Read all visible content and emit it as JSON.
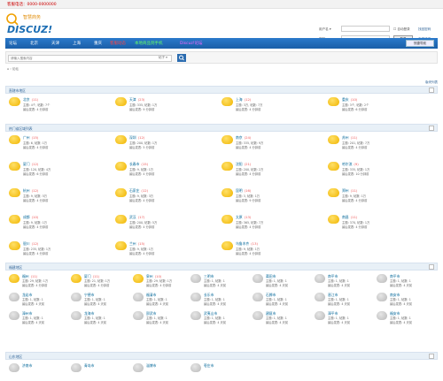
{
  "topbar": {
    "text": "客服电话：0000-0000000"
  },
  "header": {
    "logo_top": "智慧商务",
    "logo_main": "DISCUZ!"
  },
  "login": {
    "user_label": "用户名",
    "user_select": "用户名 ▾",
    "remember": "自动登录",
    "find_pwd": "找回密码",
    "pwd_label": "密码",
    "login_btn": "登录",
    "register": "立即注册"
  },
  "nav": {
    "items": [
      {
        "label": "论坛",
        "color": "#ffffff"
      },
      {
        "label": "北京",
        "color": "#ffffff"
      },
      {
        "label": "天津",
        "color": "#ffffff"
      },
      {
        "label": "上海",
        "color": "#ffffff"
      },
      {
        "label": "重庆",
        "color": "#ffffff"
      },
      {
        "label": "客服动态",
        "color": "#ff4444"
      },
      {
        "label": "本地商品到手机",
        "color": "#66ff66"
      },
      {
        "label": "Discuz!论坛",
        "color": "#ff66ff"
      }
    ],
    "right_button": "快捷导航"
  },
  "search": {
    "placeholder": "请输入搜索内容",
    "select": "帖子 ▾"
  },
  "breadcrumb": "⌂ › 论坛",
  "crumb_right": "版块列表",
  "sections": [
    {
      "title": "直辖市地区",
      "forums": [
        {
          "name": "北京",
          "new": "(11)",
          "stat": "主题: 4个, 帖数: 7个",
          "last": "最后发表: 4 分钟前"
        },
        {
          "name": "天津",
          "new": "(23)",
          "stat": "主题: 335, 帖数: 1万",
          "last": "最后发表: 9 分钟前"
        },
        {
          "name": "上海",
          "new": "(12)",
          "stat": "主题: 3万, 帖数: 7万",
          "last": "最后发表: 4 分钟前"
        },
        {
          "name": "重庆",
          "new": "(10)",
          "stat": "主题: 3个, 帖数: 2个",
          "last": "最后发表: 6 分钟前"
        }
      ]
    },
    {
      "title": "热门省区域列表",
      "forums": [
        {
          "name": "广州",
          "new": "(15)",
          "stat": "主题: 6, 帖数: 1万",
          "last": "最后发表: 4 分钟前"
        },
        {
          "name": "深圳",
          "new": "(12)",
          "stat": "主题: 200, 帖数: 1万",
          "last": "最后发表: 5 分钟前"
        },
        {
          "name": "南京",
          "new": "(24)",
          "stat": "主题: 335, 帖数: 9万",
          "last": "最后发表: 4 分钟前"
        },
        {
          "name": "苏州",
          "new": "(11)",
          "stat": "主题: 201, 帖数: 7万",
          "last": "最后发表: 4 分钟前"
        },
        {
          "name": "厦门",
          "new": "(12)",
          "stat": "主题: 120, 帖数: 4万",
          "last": "最后发表: 6 分钟前"
        },
        {
          "name": "长春市",
          "new": "(15)",
          "stat": "主题: 9, 帖数: 1万",
          "last": "最后发表: 4 分钟前"
        },
        {
          "name": "沈阳",
          "new": "(21)",
          "stat": "主题: 200, 帖数: 2万",
          "last": "最后发表: 4 分钟前"
        },
        {
          "name": "哈尔滨",
          "new": "(9)",
          "stat": "主题: 335, 帖数: 1万",
          "last": "最后发表: 10 分钟前"
        },
        {
          "name": "杭州",
          "new": "(12)",
          "stat": "主题: 9, 帖数: 5万",
          "last": "最后发表: 4 分钟前"
        },
        {
          "name": "石家庄",
          "new": "(12)",
          "stat": "主题: 9, 帖数: 3万",
          "last": "最后发表: 4 分钟前"
        },
        {
          "name": "昆明",
          "new": "(16)",
          "stat": "主题: 3, 帖数: 1万",
          "last": "最后发表: 9 分钟前"
        },
        {
          "name": "郑州",
          "new": "(11)",
          "stat": "主题: 9, 帖数: 1万",
          "last": "最后发表: 4 分钟前"
        },
        {
          "name": "成都",
          "new": "(10)",
          "stat": "主题: 9, 帖数: 1万",
          "last": "最后发表: 4 分钟前"
        },
        {
          "name": "武汉",
          "new": "(17)",
          "stat": "主题: 200, 帖数: 5万",
          "last": "最后发表: 4 分钟前"
        },
        {
          "name": "太原",
          "new": "(13)",
          "stat": "主题: 365, 帖数: 7万",
          "last": "最后发表: 4 分钟前"
        },
        {
          "name": "南昌",
          "new": "(11)",
          "stat": "主题: 370, 帖数: 1万",
          "last": "最后发表: 4 分钟前"
        },
        {
          "name": "银川",
          "new": "(12)",
          "stat": "主题: 235, 帖数: 1万",
          "last": "最后发表: 4 分钟前"
        },
        {
          "name": "兰州",
          "new": "(15)",
          "stat": "主题: 9, 帖数: 1万",
          "last": "最后发表: 4 分钟前"
        },
        {
          "name": "乌鲁木齐",
          "new": "(13)",
          "stat": "主题: 9, 帖数: 1万",
          "last": "最后发表: 4 分钟前"
        }
      ]
    },
    {
      "title": "福建地区",
      "forums": [
        {
          "name": "福州",
          "new": "(11)",
          "stat": "主题: 29, 帖数: 1万",
          "last": "最后发表: 4 分钟前",
          "gray": false
        },
        {
          "name": "厦门",
          "new": "(11)",
          "stat": "主题: 21, 帖数: 1万",
          "last": "最后发表: 4 分钟前",
          "gray": false
        },
        {
          "name": "泉州",
          "new": "(10)",
          "stat": "主题: 29, 帖数: 1万",
          "last": "最后发表: 4 分钟前",
          "gray": false
        },
        {
          "name": "三明市",
          "new": "",
          "stat": "主题: 1, 帖数: 1",
          "last": "最后发表: 4 天前",
          "gray": true
        },
        {
          "name": "莆田市",
          "new": "",
          "stat": "主题: 1, 帖数: 1",
          "last": "最后发表: 4 天前",
          "gray": true
        },
        {
          "name": "南平市",
          "new": "",
          "stat": "主题: 1, 帖数: 1",
          "last": "最后发表: 4 天前",
          "gray": true
        },
        {
          "name": "南平市",
          "new": "",
          "stat": "主题: 1, 帖数: 1",
          "last": "最后发表: 4 天前",
          "gray": true
        },
        {
          "name": "龙岩市",
          "new": "",
          "stat": "主题: 1, 帖数: 1",
          "last": "最后发表: 4 天前",
          "gray": true
        },
        {
          "name": "宁德市",
          "new": "",
          "stat": "主题: 1, 帖数: 1",
          "last": "最后发表: 4 天前",
          "gray": true
        },
        {
          "name": "福清市",
          "new": "",
          "stat": "主题: 1, 帖数: 1",
          "last": "最后发表: 4 天前",
          "gray": true
        },
        {
          "name": "长乐市",
          "new": "",
          "stat": "主题: 1, 帖数: 1",
          "last": "最后发表: 4 天前",
          "gray": true
        },
        {
          "name": "石狮市",
          "new": "",
          "stat": "主题: 1, 帖数: 1",
          "last": "最后发表: 4 天前",
          "gray": true
        },
        {
          "name": "晋江市",
          "new": "",
          "stat": "主题: 1, 帖数: 1",
          "last": "最后发表: 4 天前",
          "gray": true
        },
        {
          "name": "南安市",
          "new": "",
          "stat": "主题: 1, 帖数: 1",
          "last": "最后发表: 4 天前",
          "gray": true
        },
        {
          "name": "漳州市",
          "new": "",
          "stat": "主题: 1, 帖数: 1",
          "last": "最后发表: 4 天前",
          "gray": true
        },
        {
          "name": "龙海市",
          "new": "",
          "stat": "主题: 1, 帖数: 1",
          "last": "最后发表: 4 天前",
          "gray": true
        },
        {
          "name": "邵武市",
          "new": "",
          "stat": "主题: 1, 帖数: 1",
          "last": "最后发表: 4 天前",
          "gray": true
        },
        {
          "name": "武夷山市",
          "new": "",
          "stat": "主题: 1, 帖数: 1",
          "last": "最后发表: 4 天前",
          "gray": true
        },
        {
          "name": "建瓯市",
          "new": "",
          "stat": "主题: 1, 帖数: 1",
          "last": "最后发表: 4 天前",
          "gray": true
        },
        {
          "name": "漳平市",
          "new": "",
          "stat": "主题: 1, 帖数: 1",
          "last": "最后发表: 4 天前",
          "gray": true
        },
        {
          "name": "福安市",
          "new": "",
          "stat": "主题: 1, 帖数: 1",
          "last": "最后发表: 4 天前",
          "gray": true
        }
      ]
    },
    {
      "title": "山东地区",
      "forums": [
        {
          "name": "济南市",
          "new": "",
          "stat": "",
          "last": "",
          "gray": true
        },
        {
          "name": "青岛市",
          "new": "",
          "stat": "",
          "last": "",
          "gray": true
        },
        {
          "name": "淄博市",
          "new": "",
          "stat": "",
          "last": "",
          "gray": true
        },
        {
          "name": "枣庄市",
          "new": "",
          "stat": "",
          "last": "",
          "gray": true
        }
      ]
    }
  ]
}
